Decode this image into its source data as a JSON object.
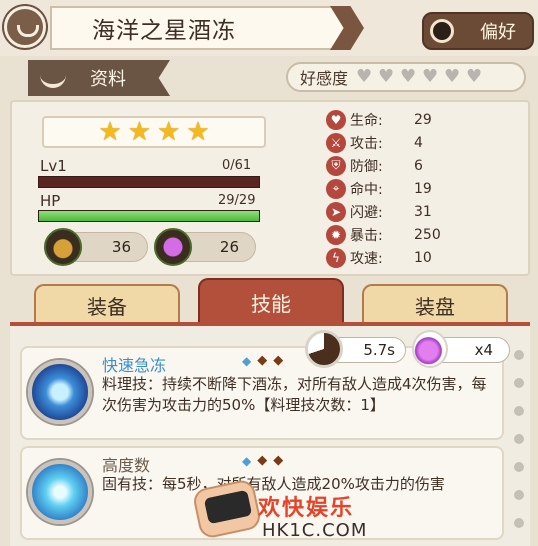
{
  "header": {
    "title": "海洋之星酒冻",
    "favorite_label": "偏好"
  },
  "info_tag": "资料",
  "favor": {
    "label": "好感度",
    "hearts_filled": 0,
    "hearts_total": 6
  },
  "rarity_stars": 4,
  "level": {
    "label": "Lv1",
    "value": "0/61",
    "progress": 0
  },
  "hp": {
    "label": "HP",
    "value": "29/29",
    "progress": 1.0
  },
  "resources": [
    {
      "icon": "acorn-icon",
      "value": "36"
    },
    {
      "icon": "gem-icon",
      "value": "26"
    }
  ],
  "stats": [
    {
      "icon": "heart-icon",
      "glyph": "♥",
      "name": "生命:",
      "value": "29"
    },
    {
      "icon": "sword-icon",
      "glyph": "⚔",
      "name": "攻击:",
      "value": "4"
    },
    {
      "icon": "shield-icon",
      "glyph": "⛨",
      "name": "防御:",
      "value": "6"
    },
    {
      "icon": "crosshair-icon",
      "glyph": "⌖",
      "name": "命中:",
      "value": "19"
    },
    {
      "icon": "dodge-icon",
      "glyph": "➤",
      "name": "闪避:",
      "value": "31"
    },
    {
      "icon": "crit-icon",
      "glyph": "✹",
      "name": "暴击:",
      "value": "250"
    },
    {
      "icon": "speed-icon",
      "glyph": "ϟ",
      "name": "攻速:",
      "value": "10"
    }
  ],
  "tabs": [
    {
      "label": "装备",
      "active": false
    },
    {
      "label": "技能",
      "active": true
    },
    {
      "label": "装盘",
      "active": false
    }
  ],
  "skill_meta": {
    "cooldown": "5.7s",
    "cost": "x4"
  },
  "skills": [
    {
      "name": "快速急冻",
      "name_color": "#3b8fd0",
      "desc": "料理技：持续不断降下酒冻，对所有敌人造成4次伤害，每次伤害为攻击力的50%【料理技次数：1】"
    },
    {
      "name": "高度数",
      "name_color": "#6b5b4c",
      "desc": "固有技：每5秒，对所有敌人造成20%攻击力的伤害"
    }
  ],
  "watermark": {
    "line1": "欢快娱乐",
    "line2": "HK1C.COM"
  },
  "colors": {
    "accent": "#b3503b",
    "hp_green": "#4eb83a",
    "star": "#f4b91c"
  }
}
